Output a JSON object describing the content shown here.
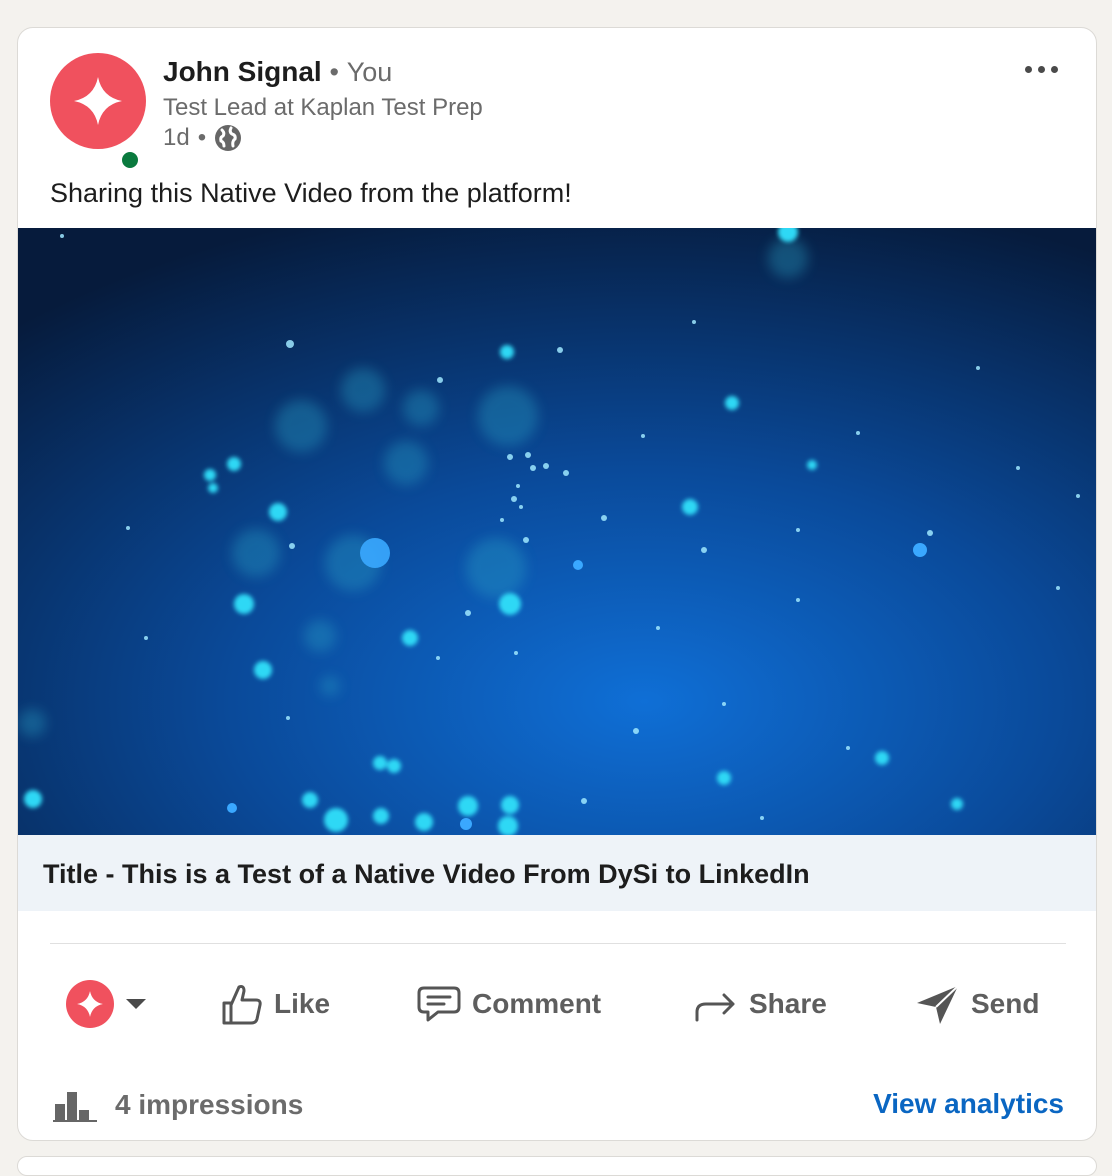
{
  "post": {
    "author": {
      "name": "John Signal",
      "relation": "You",
      "headline": "Test Lead at Kaplan Test Prep",
      "time": "1d",
      "separator": "•",
      "visibility_icon": "globe-icon",
      "avatar_icon": "sparkle-icon",
      "online": true
    },
    "text": "Sharing this Native Video from the platform!",
    "video": {
      "title": "Title - This is a Test of a Native Video From DySi to LinkedIn"
    },
    "actions": {
      "like": "Like",
      "comment": "Comment",
      "share": "Share",
      "send": "Send"
    },
    "stats": {
      "impressions": "4 impressions",
      "view_analytics": "View analytics"
    }
  },
  "colors": {
    "brand_red": "#f0515e",
    "online_green": "#0a7a3e",
    "link_blue": "#0a66c2",
    "title_bar_bg": "#eef3f8"
  }
}
